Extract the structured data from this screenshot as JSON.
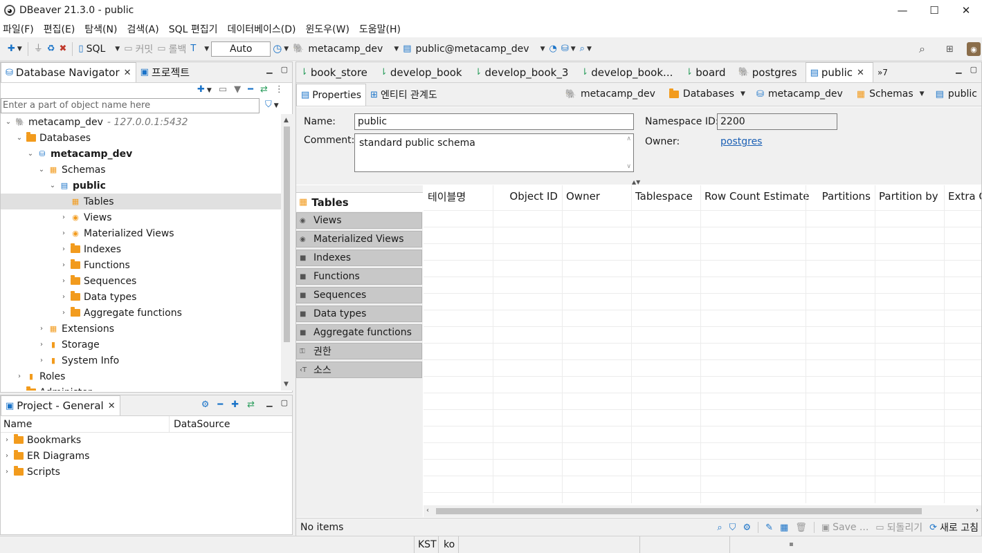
{
  "window": {
    "title": "DBeaver 21.3.0 - public",
    "minimize": "—",
    "maximize": "☐",
    "close": "✕"
  },
  "menu": [
    "파일(F)",
    "편집(E)",
    "탐색(N)",
    "검색(A)",
    "SQL 편집기",
    "데이터베이스(D)",
    "윈도우(W)",
    "도움말(H)"
  ],
  "toolbar": {
    "sql_label": "SQL",
    "commit_label": "커밋",
    "rollback_label": "롤백",
    "tx_mode": "Auto",
    "datasource": "metacamp_dev",
    "schema": "public@metacamp_dev"
  },
  "navigator": {
    "tab_label": "Database Navigator",
    "project_tab_label": "프로젝트",
    "filter_placeholder": "Enter a part of object name here",
    "tree": [
      {
        "label": "metacamp_dev",
        "suffix": " - 127.0.0.1:5432",
        "icon": "postgres-icon",
        "expanded": true
      },
      {
        "label": "Databases",
        "icon": "folder-icon",
        "expanded": true
      },
      {
        "label": "metacamp_dev",
        "icon": "database-icon",
        "expanded": true,
        "bold": true
      },
      {
        "label": "Schemas",
        "icon": "schemas-icon",
        "expanded": true
      },
      {
        "label": "public",
        "icon": "schema-icon",
        "expanded": true,
        "bold": true
      },
      {
        "label": "Tables",
        "icon": "table-icon",
        "selected": true
      },
      {
        "label": "Views",
        "icon": "view-icon"
      },
      {
        "label": "Materialized Views",
        "icon": "view-icon"
      },
      {
        "label": "Indexes",
        "icon": "folder-icon"
      },
      {
        "label": "Functions",
        "icon": "folder-icon"
      },
      {
        "label": "Sequences",
        "icon": "folder-icon"
      },
      {
        "label": "Data types",
        "icon": "folder-icon"
      },
      {
        "label": "Aggregate functions",
        "icon": "folder-icon"
      },
      {
        "label": "Extensions",
        "icon": "extensions-icon"
      },
      {
        "label": "Storage",
        "icon": "storage-icon"
      },
      {
        "label": "System Info",
        "icon": "info-icon"
      },
      {
        "label": "Roles",
        "icon": "roles-icon"
      },
      {
        "label": "Administer",
        "icon": "folder-icon"
      }
    ]
  },
  "project": {
    "tab_label": "Project - General",
    "columns": [
      "Name",
      "DataSource"
    ],
    "items": [
      "Bookmarks",
      "ER Diagrams",
      "Scripts"
    ]
  },
  "editor": {
    "tabs": [
      "book_store",
      "develop_book",
      "develop_book_3",
      "develop_book...",
      "board",
      "postgres",
      "public"
    ],
    "overflow": "»7",
    "subtabs": [
      "Properties",
      "엔티티 관계도"
    ],
    "breadcrumb": [
      "metacamp_dev",
      "Databases",
      "metacamp_dev",
      "Schemas",
      "public"
    ],
    "fields": {
      "name_label": "Name:",
      "name_value": "public",
      "comment_label": "Comment:",
      "comment_value": "standard public schema",
      "namespace_label": "Namespace ID:",
      "namespace_value": "2200",
      "owner_label": "Owner:",
      "owner_value": "postgres"
    },
    "side_tabs": [
      "Tables",
      "Views",
      "Materialized Views",
      "Indexes",
      "Functions",
      "Sequences",
      "Data types",
      "Aggregate functions",
      "권한",
      "소스"
    ],
    "columns": [
      "테이블명",
      "Object ID",
      "Owner",
      "Tablespace",
      "Row Count Estimate",
      "Partitions",
      "Partition by",
      "Extra O"
    ],
    "status": "No items",
    "save_label": "Save ...",
    "revert_label": "되돌리기",
    "refresh_label": "새로 고침"
  },
  "statusbar": {
    "timezone": "KST",
    "locale": "ko"
  },
  "colors": {
    "accent": "#1a73c8",
    "folder": "#f29b1d",
    "link": "#1a5fb4"
  }
}
